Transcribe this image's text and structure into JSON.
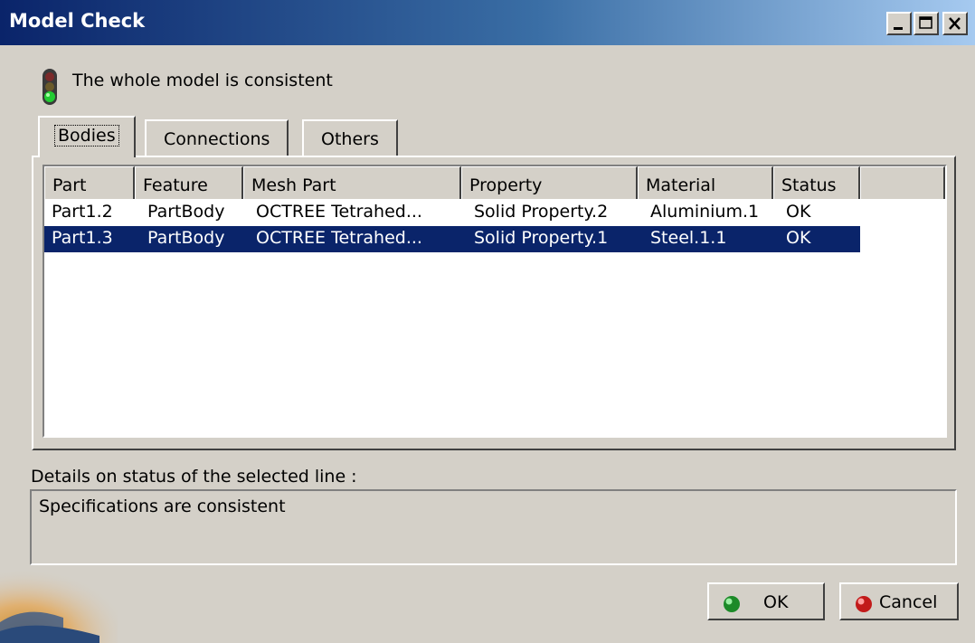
{
  "window": {
    "title": "Model Check",
    "controls": [
      "minimize-icon",
      "maximize-icon",
      "close-icon"
    ]
  },
  "status": {
    "icon": "traffic-light-green-icon",
    "message": "The whole model is consistent"
  },
  "tabs": [
    {
      "label": "Bodies",
      "active": true
    },
    {
      "label": "Connections",
      "active": false
    },
    {
      "label": "Others",
      "active": false
    }
  ],
  "table": {
    "columns": [
      "Part",
      "Feature",
      "Mesh Part",
      "Property",
      "Material",
      "Status"
    ],
    "rows": [
      {
        "cells": [
          "Part1.2",
          "PartBody",
          "OCTREE Tetrahed...",
          "Solid Property.2",
          "Aluminium.1",
          "OK"
        ],
        "selected": false
      },
      {
        "cells": [
          "Part1.3",
          "PartBody",
          "OCTREE Tetrahed...",
          "Solid Property.1",
          "Steel.1.1",
          "OK"
        ],
        "selected": true
      }
    ]
  },
  "details": {
    "label": "Details on status of the selected line :",
    "text": "Specifications are consistent"
  },
  "buttons": {
    "ok": {
      "label": "OK",
      "icon": "green-ball-icon"
    },
    "cancel": {
      "label": "Cancel",
      "icon": "red-ball-icon"
    }
  },
  "colors": {
    "selection": "#0a246a",
    "title_gradient_start": "#0a246a",
    "title_gradient_end": "#a6caf0",
    "dialog_bg": "#d4d0c8"
  }
}
